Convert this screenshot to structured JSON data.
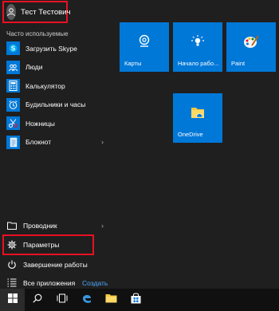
{
  "user": {
    "name": "Тест Тестович"
  },
  "most_used": {
    "title": "Часто используемые",
    "apps": [
      {
        "label": "Загрузить Skype",
        "icon": "skype-icon"
      },
      {
        "label": "Люди",
        "icon": "people-icon"
      },
      {
        "label": "Калькулятор",
        "icon": "calculator-icon"
      },
      {
        "label": "Будильники и часы",
        "icon": "alarm-clock-icon"
      },
      {
        "label": "Ножницы",
        "icon": "scissors-icon"
      },
      {
        "label": "Блокнот",
        "icon": "notepad-icon",
        "has_submenu": true
      }
    ]
  },
  "bottom": {
    "explorer": "Проводник",
    "settings": "Параметры",
    "power": "Завершение работы",
    "all_apps": "Все приложения",
    "create": "Создать"
  },
  "tiles": [
    {
      "label": "Карты",
      "icon": "maps-icon"
    },
    {
      "label": "Начало рабо...",
      "icon": "get-started-icon"
    },
    {
      "label": "Paint",
      "icon": "paint-icon"
    },
    {
      "label": "OneDrive",
      "icon": "onedrive-icon"
    }
  ],
  "taskbar": {
    "items": [
      "windows-start-icon",
      "search-icon",
      "task-view-icon",
      "edge-icon",
      "file-explorer-icon",
      "store-icon"
    ]
  },
  "colors": {
    "accent": "#0078d7",
    "highlight": "#e81123",
    "background": "#1f1f1f",
    "taskbar": "#101010",
    "link": "#4ea9ff"
  }
}
